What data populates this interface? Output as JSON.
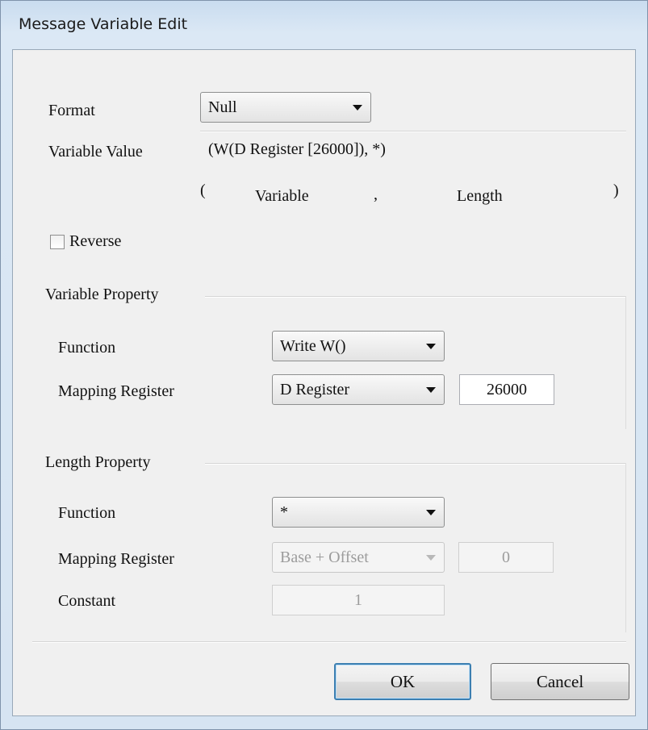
{
  "window": {
    "title": "Message Variable Edit"
  },
  "format": {
    "label": "Format",
    "value": "Null"
  },
  "variable_value": {
    "label": "Variable Value",
    "value": "(W(D Register [26000]), *)",
    "open_paren": "(",
    "variable_label": "Variable",
    "separator": ",",
    "length_label": "Length",
    "close_paren": ")"
  },
  "reverse": {
    "label": "Reverse",
    "checked": false
  },
  "variable_property": {
    "title": "Variable Property",
    "function_label": "Function",
    "function_value": "Write W()",
    "mapping_label": "Mapping Register",
    "mapping_value": "D Register",
    "address_value": "26000"
  },
  "length_property": {
    "title": "Length Property",
    "function_label": "Function",
    "function_value": "*",
    "mapping_label": "Mapping Register",
    "mapping_value": "Base + Offset",
    "offset_value": "0",
    "constant_label": "Constant",
    "constant_value": "1"
  },
  "buttons": {
    "ok": "OK",
    "cancel": "Cancel"
  }
}
